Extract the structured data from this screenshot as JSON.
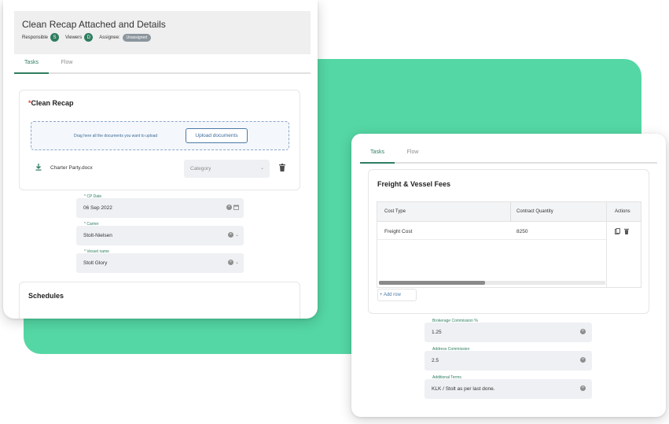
{
  "left_card": {
    "title": "Clean Recap Attached and Details",
    "meta": {
      "responsible_label": "Responsible",
      "responsible_avatar": "S",
      "viewers_label": "Viewers",
      "viewers_avatar": "D",
      "assignee_label": "Assignee:",
      "assignee_badge": "Unassigned"
    },
    "tabs": [
      "Tasks",
      "Flow"
    ],
    "clean_recap": {
      "required_mark": "*",
      "title": "Clean Recap",
      "dropzone_text": "Drag here all the documents you want to upload",
      "upload_button": "Upload documents",
      "file_name": "Charter Party.docx",
      "category_placeholder": "Category"
    },
    "fields": {
      "cp_date": {
        "label": "* CP Date",
        "value": "06 Sep 2022"
      },
      "carrier": {
        "label": "* Carrier",
        "value": "Stolt-Nielsen"
      },
      "vessel": {
        "label": "* Vessel name",
        "value": "Stolt Glory"
      }
    },
    "schedules_title": "Schedules"
  },
  "right_card": {
    "tabs": [
      "Tasks",
      "Flow"
    ],
    "panel_title": "Freight & Vessel Fees",
    "table": {
      "headers": [
        "Cost Type",
        "Contract Quantity",
        "Actions"
      ],
      "rows": [
        {
          "cost_type": "Freight Cost",
          "quantity": "8250"
        }
      ],
      "add_row": "+ Add row"
    },
    "fields": {
      "brokerage": {
        "label": "Brokerage Commission %",
        "value": "1.25"
      },
      "address": {
        "label": "Address Commission",
        "value": "2.5"
      },
      "terms": {
        "label": "Additional Terms",
        "value": "KLK / Stolt as per last done."
      }
    }
  },
  "colors": {
    "accent_green": "#2e7d61",
    "background_green": "#54d7a4",
    "required_red": "#e0443e",
    "link_blue": "#4a7aa8"
  }
}
